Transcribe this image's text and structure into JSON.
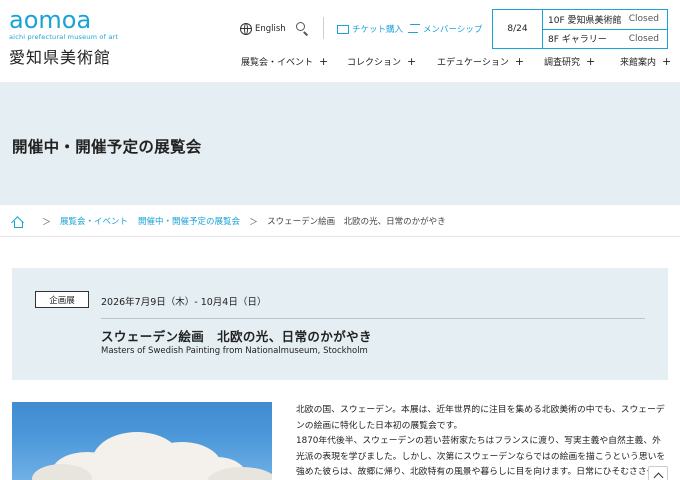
{
  "logo": {
    "mark": "aomoa",
    "subtitle": "aichi prefectural museum of art",
    "name_jp": "愛知県美術館"
  },
  "utility": {
    "language": "English",
    "ticket": "チケット購入",
    "membership": "メンバーシップ"
  },
  "status": {
    "date": "8/24",
    "rows": [
      {
        "place": "10F 愛知県美術館",
        "state": "Closed"
      },
      {
        "place": "8F ギャラリー",
        "state": "Closed"
      }
    ]
  },
  "nav": {
    "items": [
      {
        "label": "展覧会・イベント",
        "plus": "+"
      },
      {
        "label": "コレクション",
        "plus": "+"
      },
      {
        "label": "エデュケーション",
        "plus": "+"
      },
      {
        "label": "調査研究",
        "plus": "+"
      },
      {
        "label": "来館案内",
        "plus": "+"
      }
    ]
  },
  "page_title": "開催中・開催予定の展覧会",
  "breadcrumb": {
    "items": [
      "展覧会・イベント",
      "開催中・開催予定の展覧会",
      "スウェーデン絵画　北欧の光、日常のかがやき"
    ],
    "separator": "＞"
  },
  "exhibition": {
    "type": "企画展",
    "date": "2026年7月9日（木）- 10月4日（日）",
    "title": "スウェーデン絵画　北欧の光、日常のかがやき",
    "title_en": "Masters of Swedish Painting from Nationalmuseum, Stockholm"
  },
  "description": [
    "北欧の国、スウェーデン。本展は、近年世界的に注目を集める北欧美術の中でも、スウェーデンの絵画に特化した日本初の展覧会です。",
    "1870年代後半、スウェーデンの若い芸術家たちはフランスに渡り、写実主義や自然主義、外光派の表現を学びました。しかし、次第にスウェーデンならではの絵画を描こうという思いを強めた彼らは、故郷に帰り、北欧特有の風景や暮らしに目を向けます。日常にひそむささやかな美しさ"
  ],
  "colors": {
    "accent": "#1aa3d6",
    "band": "#e5eef2"
  },
  "icons": {
    "globe": "globe-icon",
    "search": "search-icon",
    "ticket": "ticket-icon",
    "member": "membership-icon",
    "home": "home-icon",
    "to_top": "chevron-up-icon"
  }
}
